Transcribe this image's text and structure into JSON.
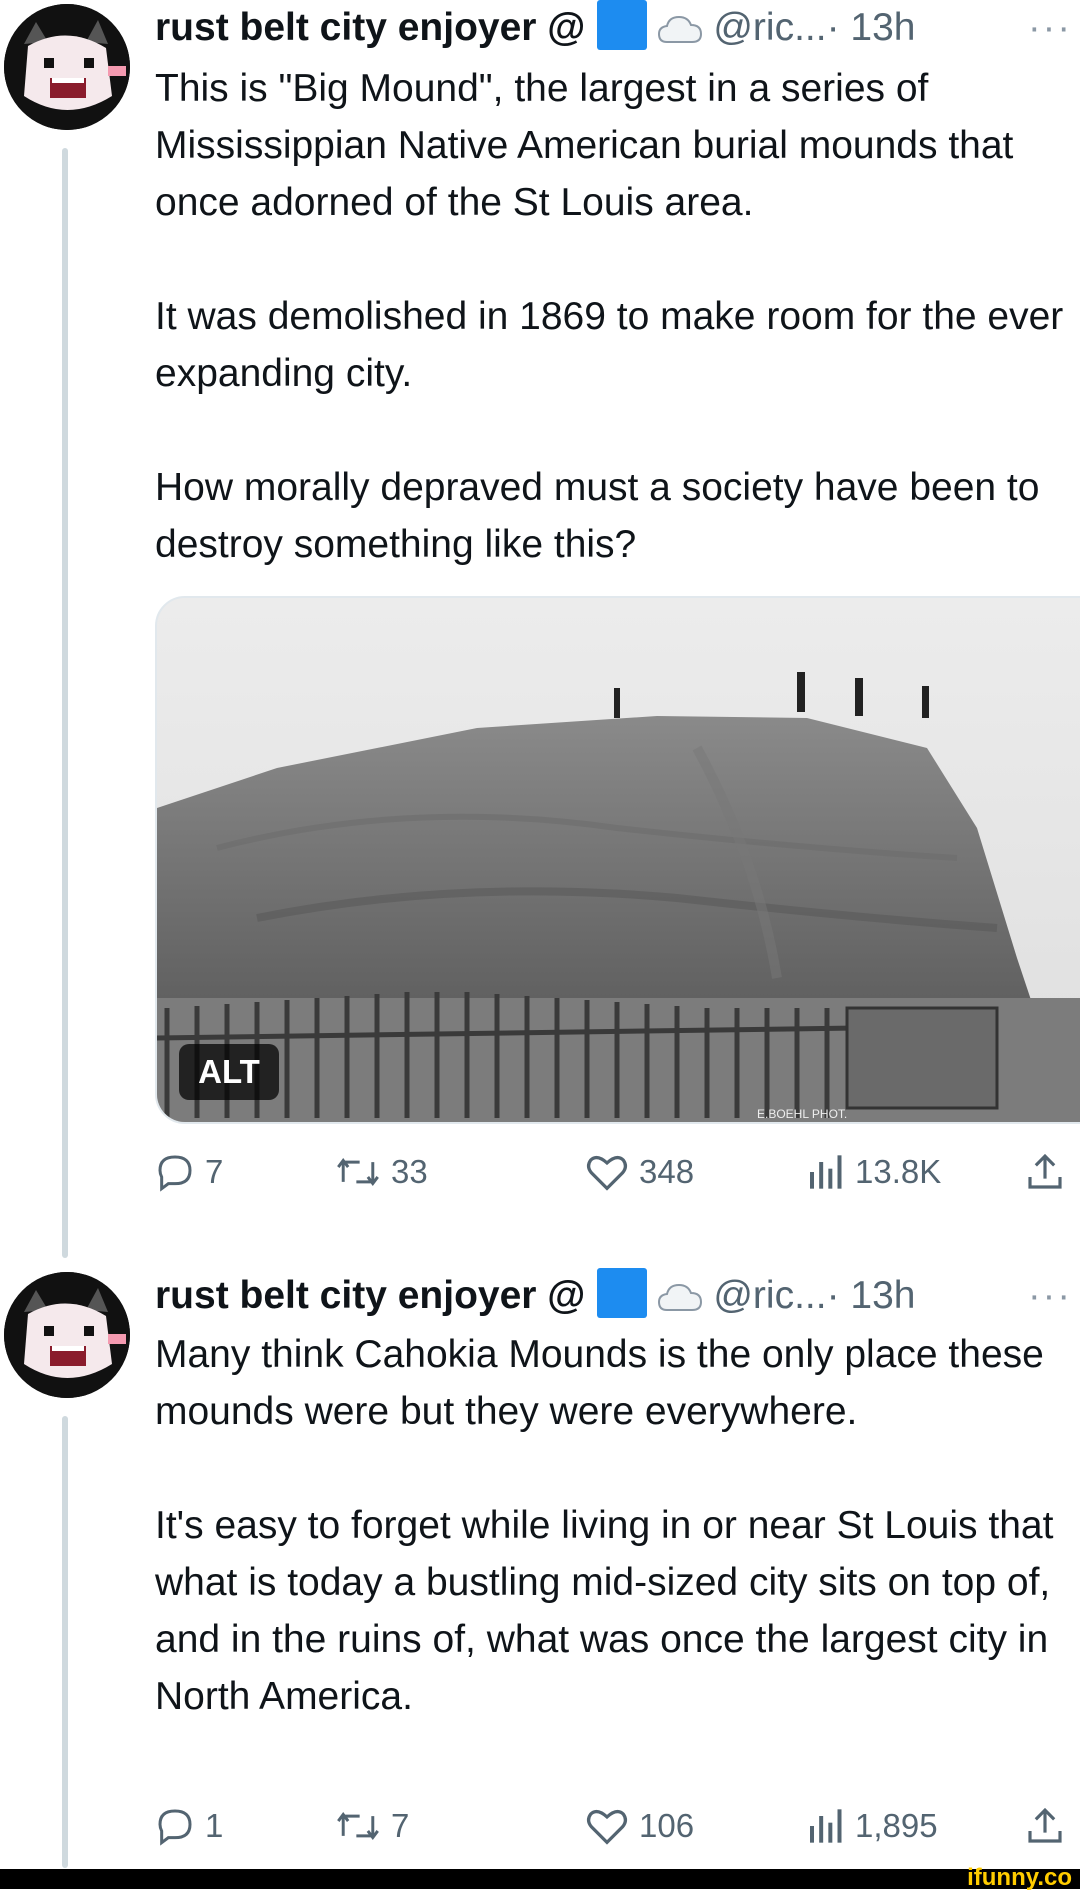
{
  "tweets": [
    {
      "author": {
        "name": "rust belt city enjoyer @",
        "handle": "@ric...",
        "time": "· 13h",
        "more": "···"
      },
      "paragraphs": [
        "This is \"Big Mound\", the largest in a series of Mississippian Native American burial mounds that once adorned of the St Louis area.",
        "It was demolished in 1869 to make room for the ever expanding city.",
        "How morally depraved must a society have been to destroy something like this?"
      ],
      "media": {
        "alt_badge": "ALT",
        "caption": "E.BOEHL PHOT."
      },
      "stats": {
        "replies": "7",
        "reposts": "33",
        "likes": "348",
        "views": "13.8K"
      }
    },
    {
      "author": {
        "name": "rust belt city enjoyer @",
        "handle": "@ric...",
        "time": "· 13h",
        "more": "···"
      },
      "paragraphs": [
        "Many think Cahokia Mounds is the only place these mounds were but they were everywhere.",
        "It's easy to forget while living in or near St Louis that what is today a bustling mid-sized city sits on top of, and in the ruins of, what was once the largest city in North America."
      ],
      "stats": {
        "replies": "1",
        "reposts": "7",
        "likes": "106",
        "views": "1,895"
      }
    }
  ],
  "watermark": "ifunny.co",
  "colors": {
    "text": "#0f1419",
    "secondary": "#536471",
    "thread_line": "#cfd9de",
    "blue_square": "#1d8cf0"
  }
}
